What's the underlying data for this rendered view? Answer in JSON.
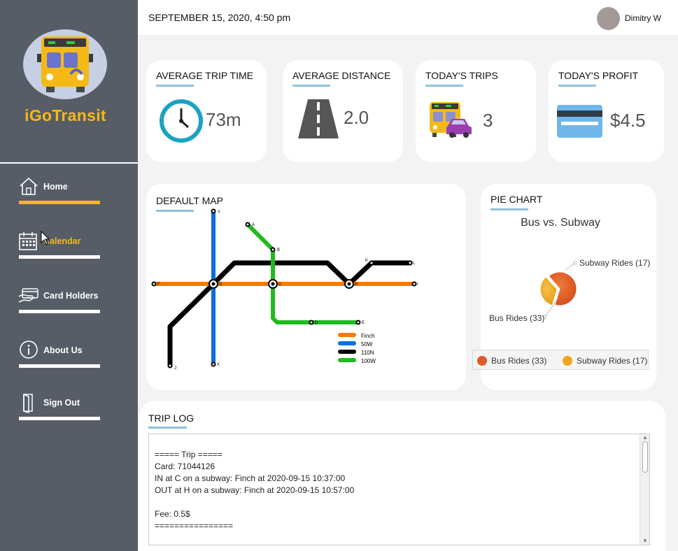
{
  "app": {
    "brand": "iGoTransit",
    "logo_icon": "bus-logo-icon"
  },
  "header": {
    "datetime": "SEPTEMBER 15, 2020, 4:50 pm",
    "user_name": "Dimitry W"
  },
  "sidebar": {
    "items": [
      {
        "label": "Home",
        "icon": "home-icon",
        "active": true
      },
      {
        "label": "Calendar",
        "icon": "calendar-icon",
        "active": false
      },
      {
        "label": "Card Holders",
        "icon": "card-holders-icon",
        "active": false
      },
      {
        "label": "About Us",
        "icon": "info-icon",
        "active": false
      },
      {
        "label": "Sign Out",
        "icon": "door-icon",
        "active": false
      }
    ]
  },
  "stats": [
    {
      "title": "AVERAGE TRIP TIME",
      "value": "73m",
      "icon": "clock-icon"
    },
    {
      "title": "AVERAGE DISTANCE",
      "value": "2.0",
      "icon": "road-icon"
    },
    {
      "title": "TODAY'S TRIPS",
      "value": "3",
      "icon": "vehicles-icon"
    },
    {
      "title": "TODAY'S PROFIT",
      "value": "$4.5",
      "icon": "credit-card-icon"
    }
  ],
  "map": {
    "title": "DEFAULT MAP",
    "station_labels": [
      "Y",
      "A",
      "B",
      "L",
      "F",
      "G",
      "C",
      "H",
      "I",
      "D",
      "E",
      "J",
      "X",
      "K"
    ],
    "legend": [
      {
        "name": "Finch",
        "color": "#f47b00"
      },
      {
        "name": "50W",
        "color": "#0a6fe0"
      },
      {
        "name": "110N",
        "color": "#000000"
      },
      {
        "name": "100W",
        "color": "#1fba1f"
      }
    ]
  },
  "pie": {
    "title": "PIE CHART",
    "subtitle": "Bus vs. Subway",
    "slices": [
      {
        "label": "Bus Rides",
        "value": 33,
        "color": "#e05a25",
        "display": "Bus Rides (33)"
      },
      {
        "label": "Subway Rides",
        "value": 17,
        "color": "#f0a41c",
        "display": "Subway Rides (17)"
      }
    ]
  },
  "trip_log": {
    "title": "TRIP LOG",
    "lines": [
      "===== Trip =====",
      "Card: 71044126",
      "IN at C on a subway: Finch at 2020-09-15 10:37:00",
      "OUT at H on a subway: Finch at 2020-09-15 10:57:00",
      "",
      "Fee: 0.5$",
      "================"
    ]
  }
}
